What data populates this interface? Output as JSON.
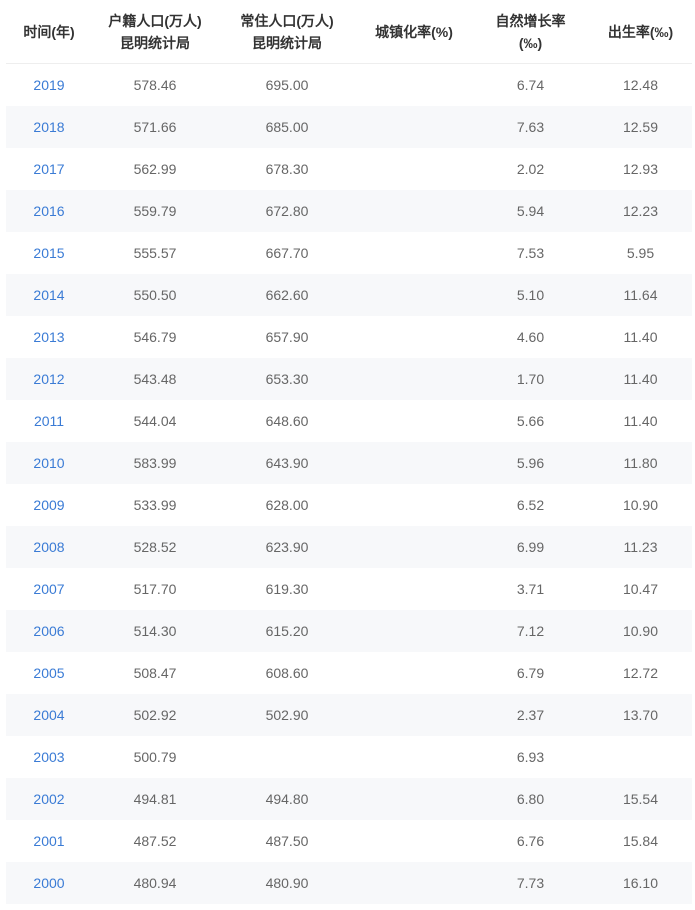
{
  "table": {
    "headers": [
      {
        "line1": "时间(年)",
        "line2": ""
      },
      {
        "line1": "户籍人口(万人)",
        "line2": "昆明统计局"
      },
      {
        "line1": "常住人口(万人)",
        "line2": "昆明统计局"
      },
      {
        "line1": "城镇化率(%)",
        "line2": ""
      },
      {
        "line1": "自然增长率",
        "line2": "(‰)"
      },
      {
        "line1": "出生率(‰)",
        "line2": ""
      }
    ],
    "rows": [
      [
        "2019",
        "578.46",
        "695.00",
        "",
        "6.74",
        "12.48"
      ],
      [
        "2018",
        "571.66",
        "685.00",
        "",
        "7.63",
        "12.59"
      ],
      [
        "2017",
        "562.99",
        "678.30",
        "",
        "2.02",
        "12.93"
      ],
      [
        "2016",
        "559.79",
        "672.80",
        "",
        "5.94",
        "12.23"
      ],
      [
        "2015",
        "555.57",
        "667.70",
        "",
        "7.53",
        "5.95"
      ],
      [
        "2014",
        "550.50",
        "662.60",
        "",
        "5.10",
        "11.64"
      ],
      [
        "2013",
        "546.79",
        "657.90",
        "",
        "4.60",
        "11.40"
      ],
      [
        "2012",
        "543.48",
        "653.30",
        "",
        "1.70",
        "11.40"
      ],
      [
        "2011",
        "544.04",
        "648.60",
        "",
        "5.66",
        "11.40"
      ],
      [
        "2010",
        "583.99",
        "643.90",
        "",
        "5.96",
        "11.80"
      ],
      [
        "2009",
        "533.99",
        "628.00",
        "",
        "6.52",
        "10.90"
      ],
      [
        "2008",
        "528.52",
        "623.90",
        "",
        "6.99",
        "11.23"
      ],
      [
        "2007",
        "517.70",
        "619.30",
        "",
        "3.71",
        "10.47"
      ],
      [
        "2006",
        "514.30",
        "615.20",
        "",
        "7.12",
        "10.90"
      ],
      [
        "2005",
        "508.47",
        "608.60",
        "",
        "6.79",
        "12.72"
      ],
      [
        "2004",
        "502.92",
        "502.90",
        "",
        "2.37",
        "13.70"
      ],
      [
        "2003",
        "500.79",
        "",
        "",
        "6.93",
        ""
      ],
      [
        "2002",
        "494.81",
        "494.80",
        "",
        "6.80",
        "15.54"
      ],
      [
        "2001",
        "487.52",
        "487.50",
        "",
        "6.76",
        "15.84"
      ],
      [
        "2000",
        "480.94",
        "480.90",
        "",
        "7.73",
        "16.10"
      ]
    ]
  },
  "colors": {
    "link": "#3a7bd5",
    "stripe": "#f7f8fa",
    "text": "#666666",
    "header_text": "#333333"
  }
}
